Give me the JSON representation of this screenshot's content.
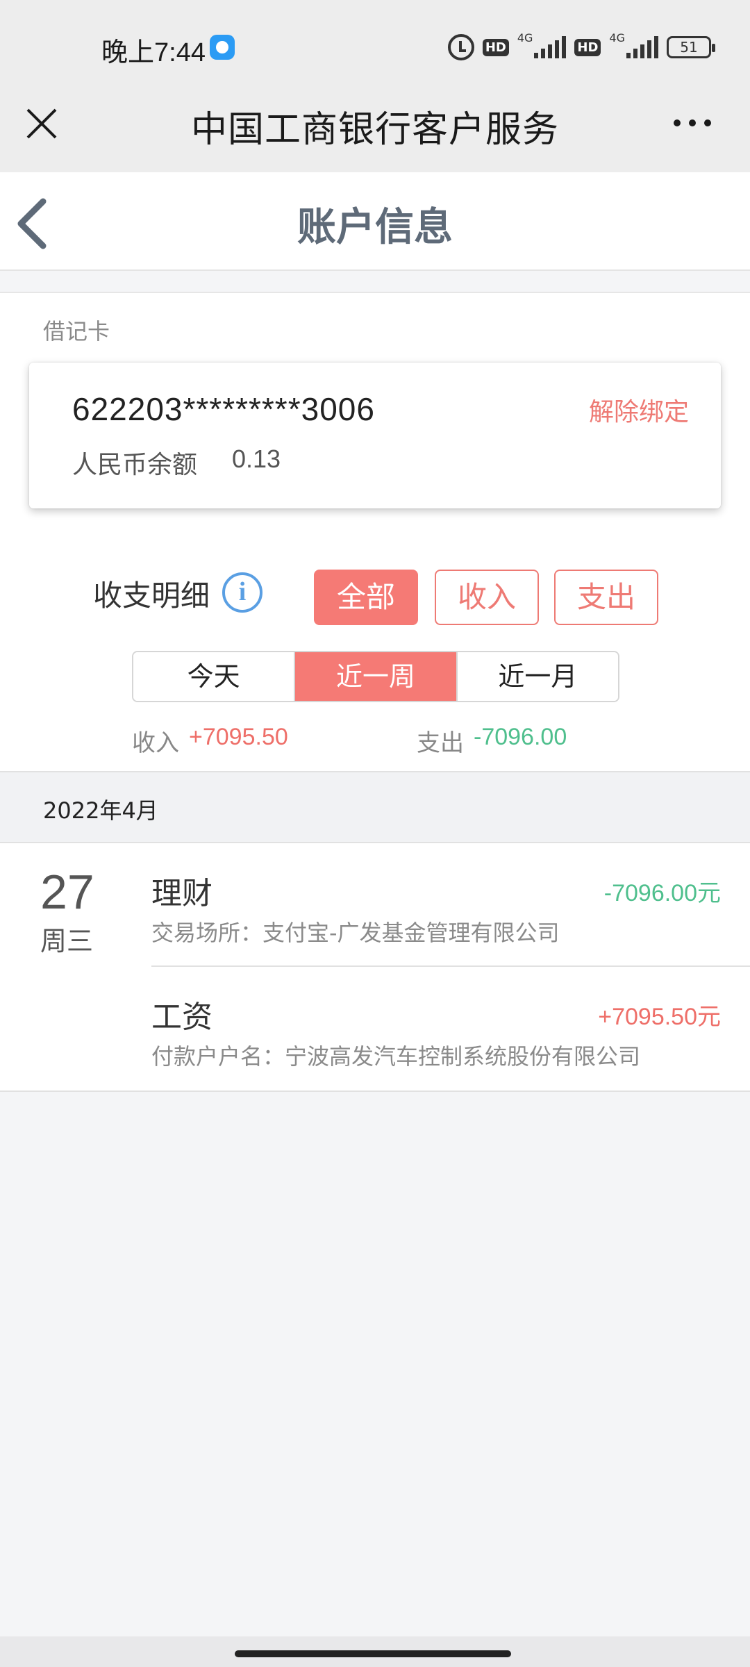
{
  "status_bar": {
    "time": "晚上7:44",
    "hd": "HD",
    "network": "4G",
    "battery": "51"
  },
  "mini_program": {
    "title": "中国工商银行客户服务"
  },
  "page": {
    "title": "账户信息"
  },
  "card": {
    "type_label": "借记卡",
    "number": "622203*********3006",
    "unbind_label": "解除绑定",
    "balance_label": "人民币余额",
    "balance_value": "0.13"
  },
  "details": {
    "label": "收支明细",
    "type_filters": [
      {
        "label": "全部",
        "active": true
      },
      {
        "label": "收入",
        "active": false
      },
      {
        "label": "支出",
        "active": false
      }
    ],
    "range_filters": [
      {
        "label": "今天",
        "active": false
      },
      {
        "label": "近一周",
        "active": true
      },
      {
        "label": "近一月",
        "active": false
      }
    ],
    "summary": {
      "income_label": "收入",
      "income_value": "+7095.50",
      "expense_label": "支出",
      "expense_value": "-7096.00"
    }
  },
  "transactions": {
    "month": "2022年4月",
    "groups": [
      {
        "day": "27",
        "weekday": "周三",
        "items": [
          {
            "title": "理财",
            "amount": "-7096.00元",
            "desc": "交易场所：支付宝-广发基金管理有限公司"
          },
          {
            "title": "工资",
            "amount": "+7095.50元",
            "desc": "付款户户名：宁波高发汽车控制系统股份有限公司"
          }
        ]
      }
    ]
  },
  "colors": {
    "accent": "#f57a75",
    "expense": "#4fbf8d",
    "income": "#ee6f69",
    "info": "#5a9fe3"
  }
}
